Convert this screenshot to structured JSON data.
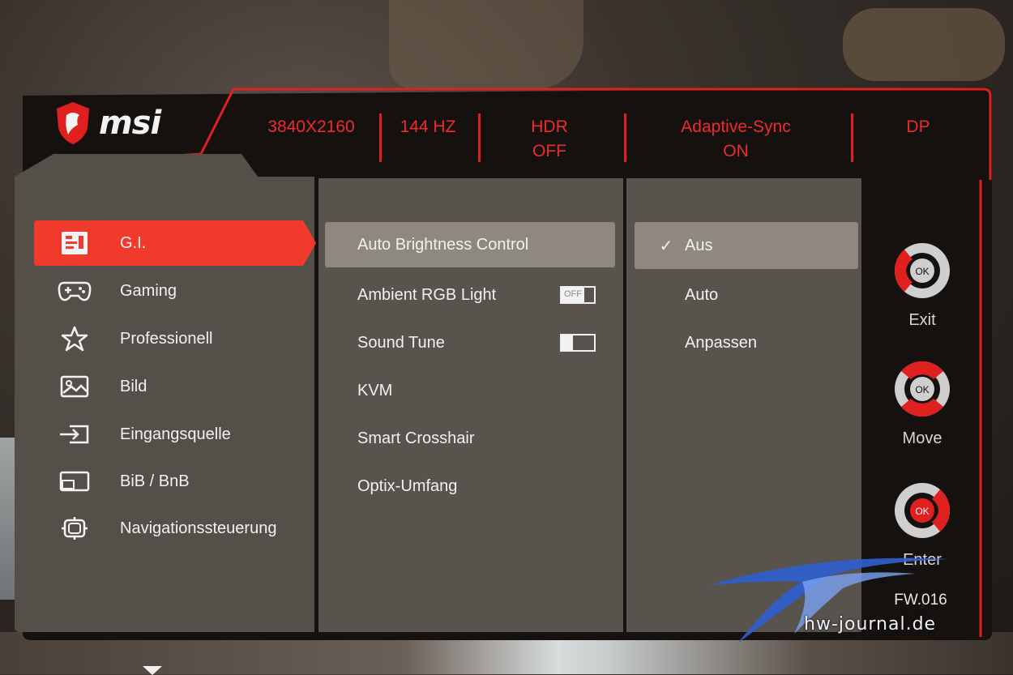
{
  "brand": {
    "logo_text": "msi"
  },
  "topbar": {
    "resolution": "3840X2160",
    "refresh": "144 HZ",
    "hdr_label": "HDR",
    "hdr_value": "OFF",
    "sync_label": "Adaptive-Sync",
    "sync_value": "ON",
    "input": "DP"
  },
  "menu": {
    "items": [
      {
        "label": "G.I.",
        "icon": "gi-chip-icon"
      },
      {
        "label": "Gaming",
        "icon": "gamepad-icon"
      },
      {
        "label": "Professionell",
        "icon": "star-icon"
      },
      {
        "label": "Bild",
        "icon": "image-icon"
      },
      {
        "label": "Eingangsquelle",
        "icon": "input-source-icon"
      },
      {
        "label": "BiB / BnB",
        "icon": "pip-icon"
      },
      {
        "label": "Navigationssteuerung",
        "icon": "navigation-icon"
      }
    ],
    "active_index": 0
  },
  "options": {
    "items": [
      {
        "label": "Auto Brightness Control"
      },
      {
        "label": "Ambient RGB Light",
        "toggle": "OFF"
      },
      {
        "label": "Sound Tune",
        "toggle": "ON"
      },
      {
        "label": "KVM"
      },
      {
        "label": "Smart Crosshair"
      },
      {
        "label": "Optix-Umfang"
      }
    ],
    "toggle_off_text": "OFF",
    "toggle_on_text": "ON"
  },
  "values": {
    "items": [
      {
        "label": "Aus",
        "checked": true
      },
      {
        "label": "Auto",
        "checked": false
      },
      {
        "label": "Anpassen",
        "checked": false
      }
    ],
    "check_glyph": "✓"
  },
  "keys": {
    "exit": "Exit",
    "move": "Move",
    "enter": "Enter",
    "ok": "OK"
  },
  "firmware": "FW.016",
  "watermark": "hw-journal.de",
  "colors": {
    "accent_red": "#ef2b2b",
    "panel_gray": "#58534d",
    "selection_gray": "#8e8880",
    "frame_black": "#15110f"
  }
}
